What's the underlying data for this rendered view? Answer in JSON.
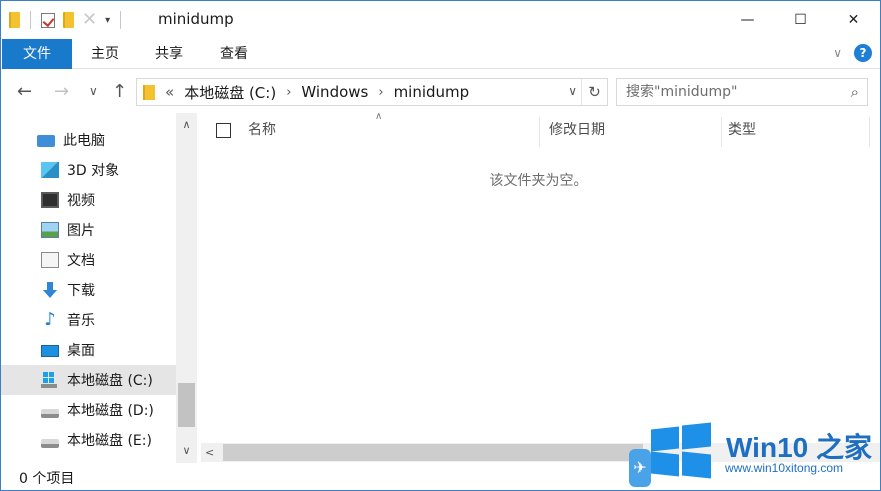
{
  "titlebar": {
    "title": "minidump",
    "qat_dropdown": "▾",
    "minimize": "—",
    "maximize": "☐",
    "close": "✕"
  },
  "ribbon": {
    "tabs": [
      {
        "label": "文件"
      },
      {
        "label": "主页"
      },
      {
        "label": "共享"
      },
      {
        "label": "查看"
      }
    ],
    "help": "?",
    "expand_chevron": "∨",
    "file_tab_color": "#1979ca"
  },
  "nav": {
    "back": "←",
    "forward": "→",
    "recent": "∨",
    "up": "↑"
  },
  "address": {
    "overflow": "«",
    "crumbs": [
      "本地磁盘 (C:)",
      "Windows",
      "minidump"
    ],
    "separator": "›",
    "dropdown": "∨",
    "refresh": "↻"
  },
  "search": {
    "placeholder": "搜索\"minidump\"",
    "icon": "search-icon"
  },
  "sidebar": {
    "items": [
      {
        "label": "此电脑",
        "icon": "computer-icon"
      },
      {
        "label": "3D 对象",
        "icon": "3d-objects-icon"
      },
      {
        "label": "视频",
        "icon": "video-icon"
      },
      {
        "label": "图片",
        "icon": "pictures-icon"
      },
      {
        "label": "文档",
        "icon": "documents-icon"
      },
      {
        "label": "下载",
        "icon": "download-icon"
      },
      {
        "label": "音乐",
        "icon": "music-icon"
      },
      {
        "label": "桌面",
        "icon": "desktop-icon"
      },
      {
        "label": "本地磁盘 (C:)",
        "icon": "windows-drive-icon",
        "selected": true
      },
      {
        "label": "本地磁盘 (D:)",
        "icon": "drive-icon"
      },
      {
        "label": "本地磁盘 (E:)",
        "icon": "drive-icon"
      }
    ],
    "scroll_up": "∧",
    "scroll_down": "∨",
    "selected_bg": "#e5e5e5"
  },
  "content": {
    "columns": [
      "名称",
      "修改日期",
      "类型"
    ],
    "sort_indicator": "∧",
    "empty_message": "该文件夹为空。",
    "hscroll_left": "<"
  },
  "status": {
    "item_count": "0 个项目"
  },
  "watermark": {
    "brand": "Win10 之家",
    "url": "www.win10xitong.com",
    "color": "#1e6fc2"
  }
}
